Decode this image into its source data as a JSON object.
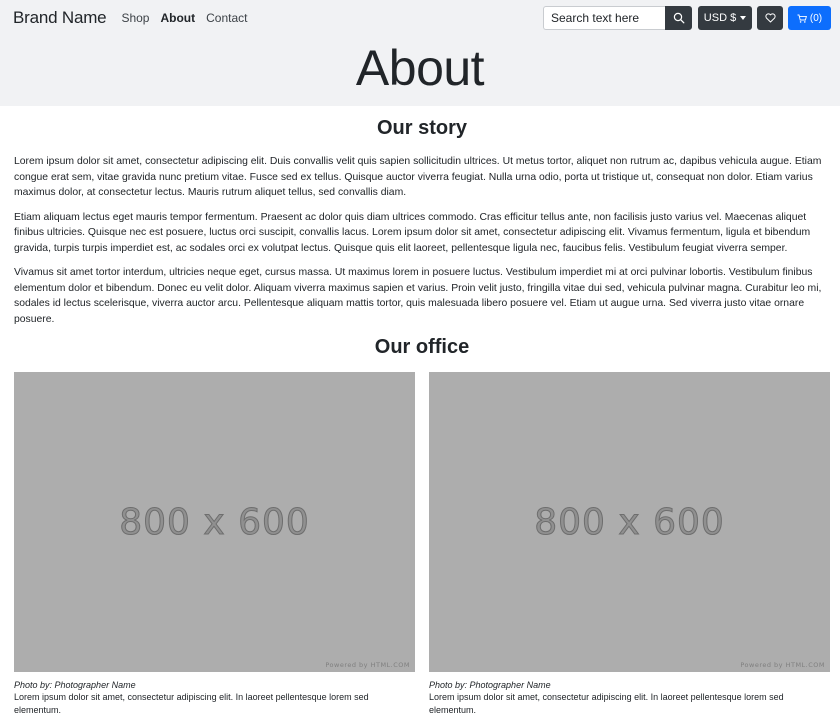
{
  "navbar": {
    "brand": "Brand Name",
    "links": [
      {
        "label": "Shop",
        "active": false
      },
      {
        "label": "About",
        "active": true
      },
      {
        "label": "Contact",
        "active": false
      }
    ],
    "search_placeholder": "Search text here",
    "search_icon": "search-icon",
    "currency_label": "USD $",
    "wishlist_icon": "heart-icon",
    "cart_icon": "cart-icon",
    "cart_count": "(0)",
    "accent_color": "#0d6efd",
    "dark_color": "#343a40"
  },
  "page": {
    "title": "About"
  },
  "story": {
    "title": "Our story",
    "paragraphs": [
      "Lorem ipsum dolor sit amet, consectetur adipiscing elit. Duis convallis velit quis sapien sollicitudin ultrices. Ut metus tortor, aliquet non rutrum ac, dapibus vehicula augue. Etiam congue erat sem, vitae gravida nunc pretium vitae. Fusce sed ex tellus. Quisque auctor viverra feugiat. Nulla urna odio, porta ut tristique ut, consequat non dolor. Etiam varius maximus dolor, at consectetur lectus. Mauris rutrum aliquet tellus, sed convallis diam.",
      "Etiam aliquam lectus eget mauris tempor fermentum. Praesent ac dolor quis diam ultrices commodo. Cras efficitur tellus ante, non facilisis justo varius vel. Maecenas aliquet finibus ultricies. Quisque nec est posuere, luctus orci suscipit, convallis lacus. Lorem ipsum dolor sit amet, consectetur adipiscing elit. Vivamus fermentum, ligula et bibendum gravida, turpis turpis imperdiet est, ac sodales orci ex volutpat lectus. Quisque quis elit laoreet, pellentesque ligula nec, faucibus felis. Vestibulum feugiat viverra semper.",
      "Vivamus sit amet tortor interdum, ultricies neque eget, cursus massa. Ut maximus lorem in posuere luctus. Vestibulum imperdiet mi at orci pulvinar lobortis. Vestibulum finibus elementum dolor et bibendum. Donec eu velit dolor. Aliquam viverra maximus sapien et varius. Proin velit justo, fringilla vitae dui sed, vehicula pulvinar magna. Curabitur leo mi, sodales id lectus scelerisque, viverra auctor arcu. Pellentesque aliquam mattis tortor, quis malesuada libero posuere vel. Etiam ut augue urna. Sed viverra justo vitae ornare posuere."
    ]
  },
  "office": {
    "title": "Our office",
    "photos": [
      {
        "placeholder_text": "800 x 600",
        "placeholder_credit": "Powered by HTML.COM",
        "credit": "Photo by: Photographer Name",
        "caption": "Lorem ipsum dolor sit amet, consectetur adipiscing elit. In laoreet pellentesque lorem sed elementum."
      },
      {
        "placeholder_text": "800 x 600",
        "placeholder_credit": "Powered by HTML.COM",
        "credit": "Photo by: Photographer Name",
        "caption": "Lorem ipsum dolor sit amet, consectetur adipiscing elit. In laoreet pellentesque lorem sed elementum."
      }
    ]
  }
}
